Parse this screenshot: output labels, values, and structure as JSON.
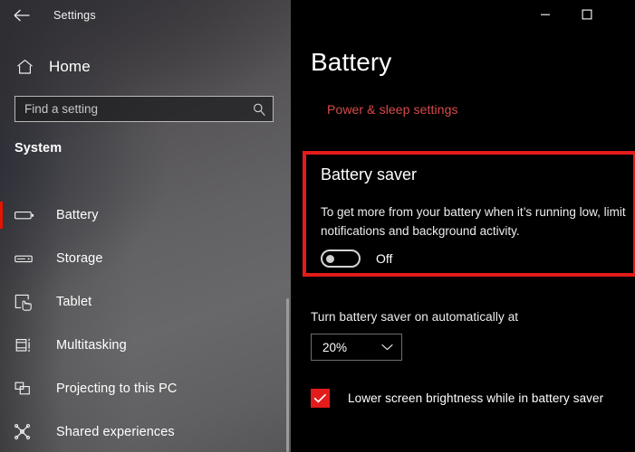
{
  "window": {
    "title": "Settings",
    "back_icon": "back-arrow-icon",
    "controls": {
      "minimize_label": "—",
      "maximize_label": "☐",
      "close_label": ""
    }
  },
  "sidebar": {
    "home": {
      "label": "Home",
      "icon": "home-icon"
    },
    "search": {
      "placeholder": "Find a setting",
      "value": "",
      "icon": "search-icon"
    },
    "section_heading": "System",
    "items": [
      {
        "label": "Battery",
        "icon": "battery-icon",
        "selected": true
      },
      {
        "label": "Storage",
        "icon": "storage-icon",
        "selected": false
      },
      {
        "label": "Tablet",
        "icon": "tablet-icon",
        "selected": false
      },
      {
        "label": "Multitasking",
        "icon": "multitasking-icon",
        "selected": false
      },
      {
        "label": "Projecting to this PC",
        "icon": "projecting-icon",
        "selected": false
      },
      {
        "label": "Shared experiences",
        "icon": "shared-experiences-icon",
        "selected": false
      }
    ]
  },
  "main": {
    "page_title": "Battery",
    "power_sleep_link": "Power & sleep settings",
    "battery_saver": {
      "title": "Battery saver",
      "description": "To get more from your battery when it’s running low, limit notifications and background activity.",
      "toggle_state": "Off",
      "toggle_on": false
    },
    "auto_on_label": "Turn battery saver on automatically at",
    "threshold": {
      "value": "20%",
      "chevron_icon": "chevron-down-icon"
    },
    "lower_brightness": {
      "label": "Lower screen brightness while in battery saver",
      "checked": true
    }
  },
  "colors": {
    "accent_red": "#e41b1b",
    "selection_red": "#e51400",
    "link_red": "#d94a4a",
    "content_background": "#000000"
  }
}
